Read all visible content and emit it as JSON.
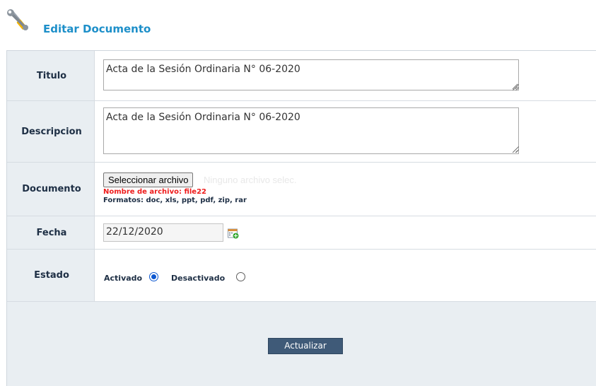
{
  "page": {
    "title": "Editar Documento",
    "icon": "tools-icon"
  },
  "form": {
    "titulo": {
      "label": "Titulo",
      "value": "Acta de la Sesión Ordinaria N° 06-2020"
    },
    "descripcion": {
      "label": "Descripcion",
      "value": "Acta de la Sesión Ordinaria N° 06-2020"
    },
    "documento": {
      "label": "Documento",
      "button_label": "Seleccionar archivo",
      "file_status": "Ninguno archivo selec.",
      "file_name": "Nombre de archivo: file22",
      "formats": "Formatos: doc, xls, ppt, pdf, zip, rar"
    },
    "fecha": {
      "label": "Fecha",
      "value": "22/12/2020",
      "icon": "calendar-icon"
    },
    "estado": {
      "label": "Estado",
      "options": [
        {
          "label": "Activado",
          "checked": true
        },
        {
          "label": "Desactivado",
          "checked": false
        }
      ]
    }
  },
  "actions": {
    "submit_label": "Actualizar"
  },
  "colors": {
    "title": "#1d8fc9",
    "label_bg": "#e9eef2",
    "label_text": "#1e2f45",
    "error": "#ee1b1b",
    "button_bg": "#3f5a78"
  }
}
